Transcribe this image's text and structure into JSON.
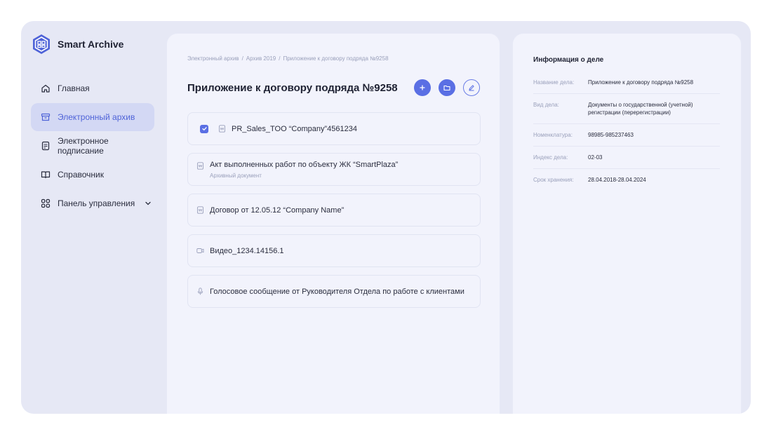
{
  "app": {
    "name": "Smart Archive",
    "accent": "#5a6fe4"
  },
  "nav": {
    "items": [
      {
        "label": "Главная",
        "icon": "home-icon"
      },
      {
        "label": "Электронный архив",
        "icon": "archive-box-icon",
        "active": true
      },
      {
        "label": "Электронное подписание",
        "icon": "signed-document-icon"
      },
      {
        "label": "Справочник",
        "icon": "open-book-icon"
      },
      {
        "label": "Панель управления",
        "icon": "grid-icon",
        "expandable": true
      }
    ]
  },
  "main": {
    "breadcrumb": [
      "Электронный архив",
      "Архив 2019",
      "Приложение к договору подряда №9258"
    ],
    "breadcrumb_sep": "/",
    "title": "Приложение к договору подряда №9258",
    "actions": [
      "add-icon",
      "folder-icon",
      "edit-pencil-icon"
    ],
    "documents": [
      {
        "name": "PR_Sales_TOO “Company”4561234",
        "icon": "word-file-icon",
        "checked": true,
        "subtitle": ""
      },
      {
        "name": "Акт выполненных работ по объекту ЖК “SmartPlaza”",
        "icon": "word-file-icon",
        "subtitle": "Архивный документ"
      },
      {
        "name": "Договор от 12.05.12 “Company Name”",
        "icon": "word-file-icon",
        "subtitle": ""
      },
      {
        "name": "Видео_1234.14156.1",
        "icon": "video-camera-icon",
        "subtitle": ""
      },
      {
        "name": "Голосовое сообщение от Руководителя Отдела по работе с клиентами",
        "icon": "microphone-icon",
        "subtitle": ""
      }
    ]
  },
  "info": {
    "title": "Информация о деле",
    "rows": [
      {
        "key": "Название дела:",
        "value": "Приложение к договору подряда №9258"
      },
      {
        "key": "Вид дела:",
        "value": "Документы о государственной (учетной) регистрации (перерегистрации)"
      },
      {
        "key": "Номенклатура:",
        "value": "98985-985237463"
      },
      {
        "key": "Индекс дела:",
        "value": "02-03"
      },
      {
        "key": "Срок хранения:",
        "value": "28.04.2018-28.04.2024"
      }
    ]
  }
}
